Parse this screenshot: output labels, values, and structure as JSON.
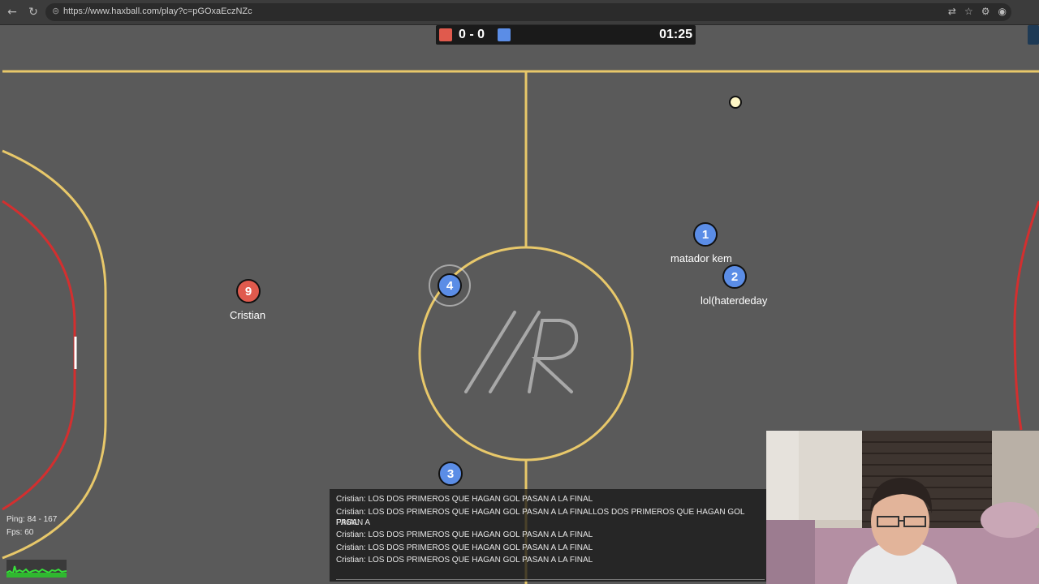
{
  "browser": {
    "url": "https://www.haxball.com/play?c=pGOxaEczNZc"
  },
  "scoreboard": {
    "red_score": "0",
    "separator": "-",
    "blue_score": "0",
    "timer": "01:25",
    "red_color": "#e05a4d",
    "blue_color": "#5b8de6"
  },
  "field": {
    "line_color": "#e8c86a",
    "goal_color": "#d32f2f",
    "center_logo": "AR"
  },
  "players": [
    {
      "number": "1",
      "name": "matador  kem",
      "team": "blue"
    },
    {
      "number": "2",
      "name": "lol(haterdeday",
      "team": "blue"
    },
    {
      "number": "4",
      "name": "",
      "team": "blue"
    },
    {
      "number": "3",
      "name": "",
      "team": "blue"
    },
    {
      "number": "9",
      "name": "Cristian",
      "team": "red"
    }
  ],
  "chat": {
    "messages": [
      "Cristian: LOS DOS PRIMEROS QUE HAGAN GOL PASAN A LA FINAL",
      "Cristian: LOS DOS PRIMEROS QUE HAGAN GOL PASAN A LA FINALLOS DOS PRIMEROS QUE HAGAN GOL PASAN A",
      "FINAL",
      "Cristian: LOS DOS PRIMEROS QUE HAGAN GOL PASAN A LA FINAL",
      "Cristian: LOS DOS PRIMEROS QUE HAGAN GOL PASAN A LA FINAL",
      "Cristian: LOS DOS PRIMEROS QUE HAGAN GOL PASAN A LA FINAL"
    ]
  },
  "stats": {
    "ping": "Ping: 84 - 167",
    "fps": "Fps: 60"
  }
}
